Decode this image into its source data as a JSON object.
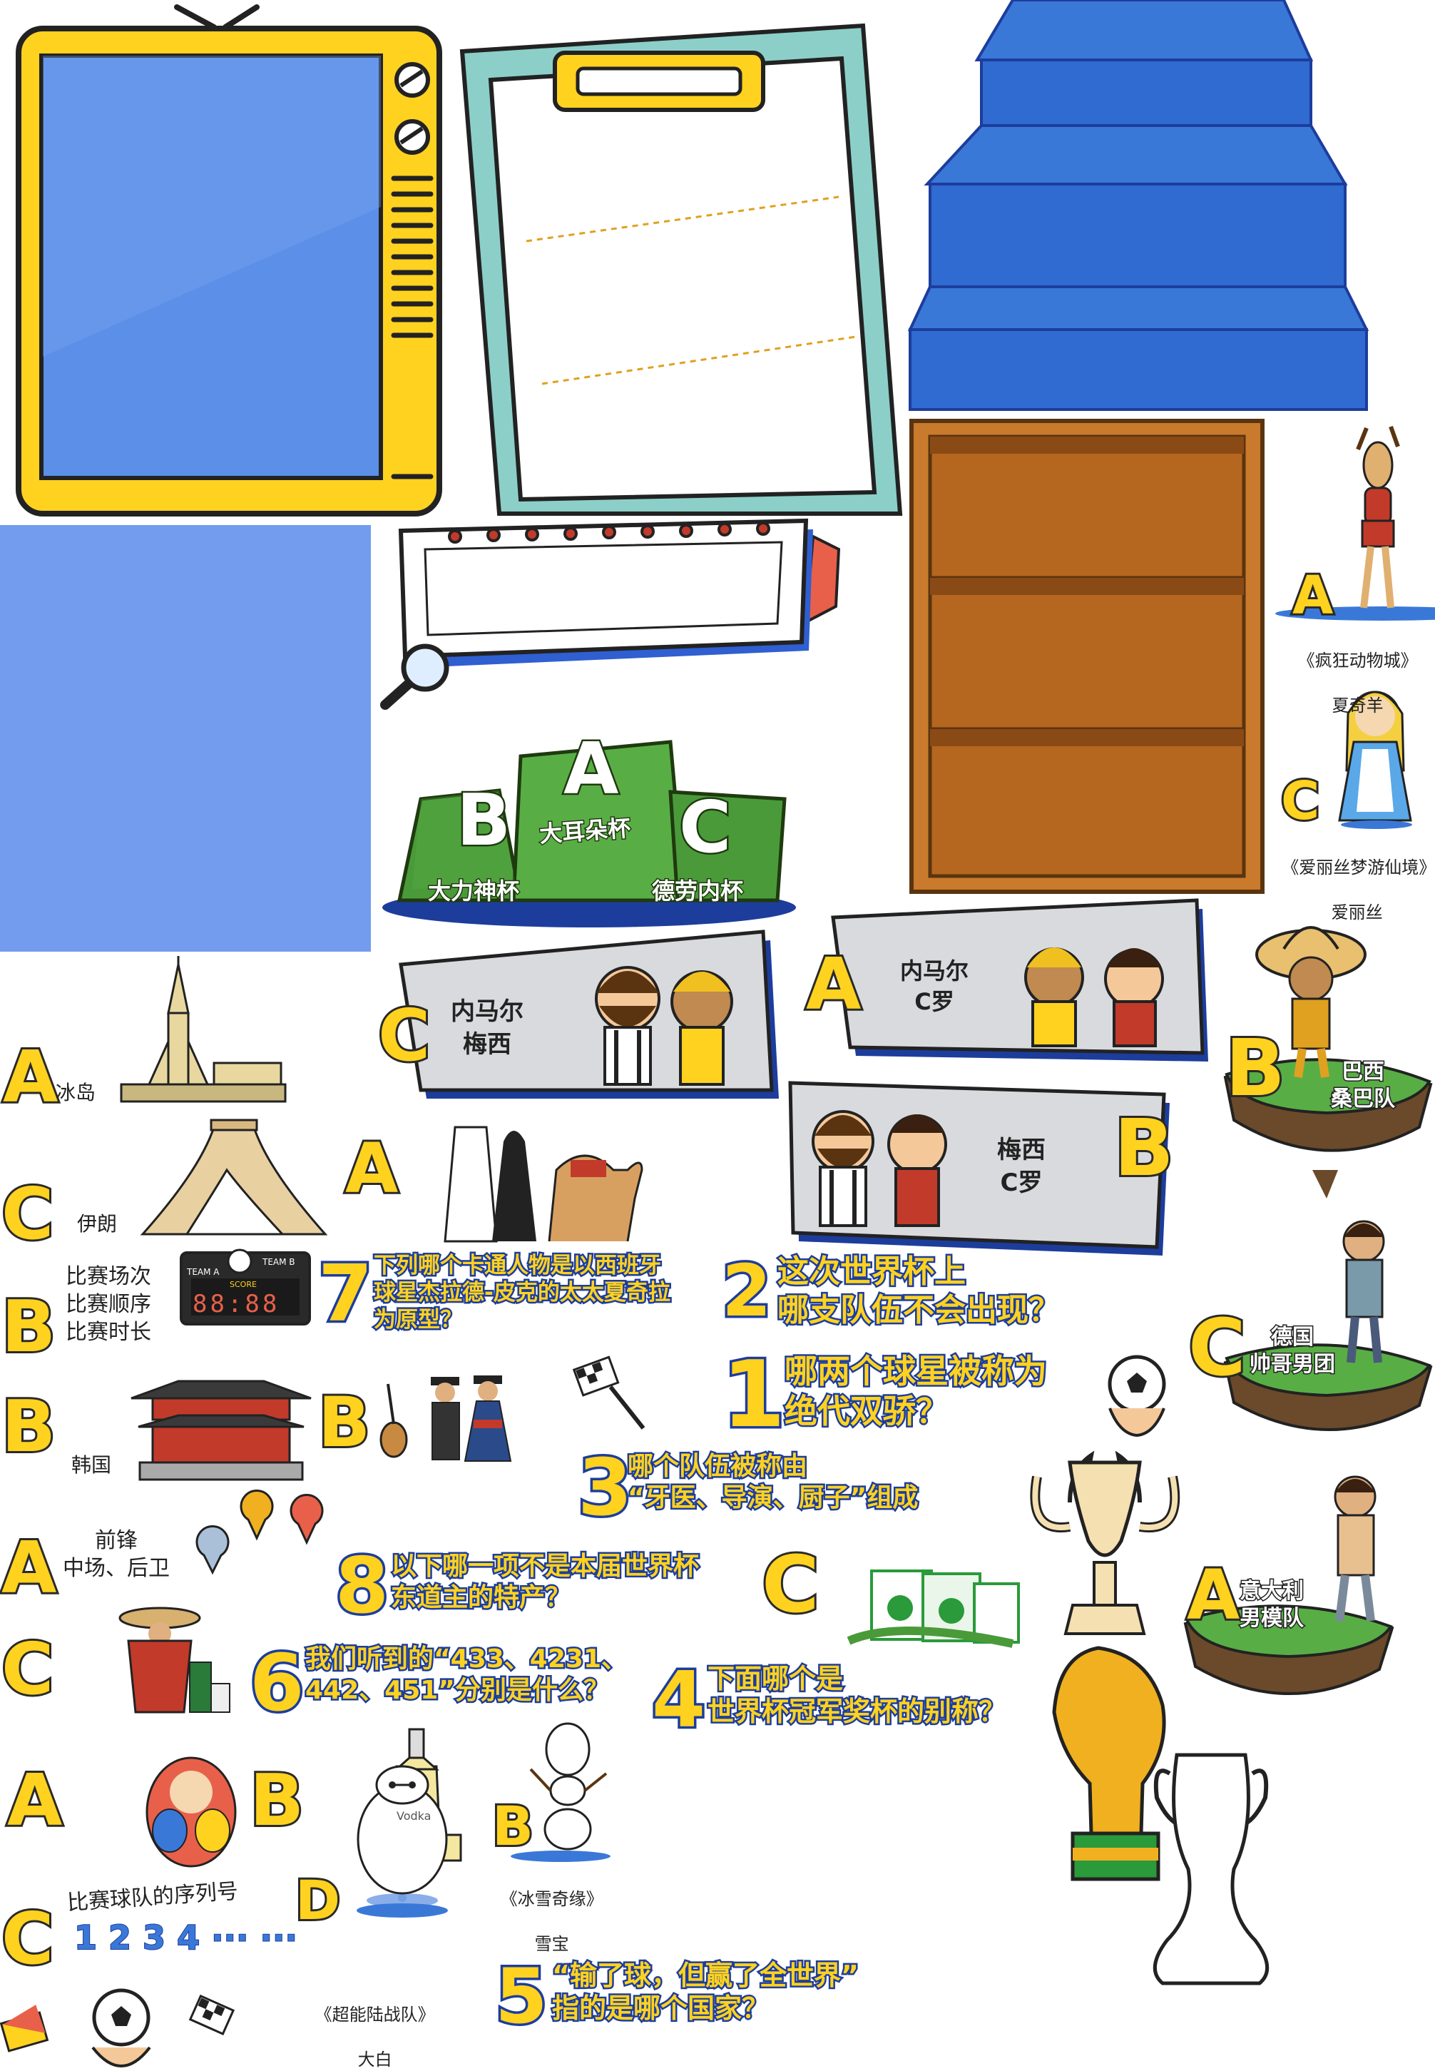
{
  "colors": {
    "accent_yellow": "#ffd21f",
    "outline_blue": "#1d3d9c",
    "tv_screen": "#5b8fe8",
    "stage_blue": "#3a78d8",
    "panel_blue": "#739cef",
    "pedestal_green": "#4a9a3a",
    "shelf_brown": "#b5661f",
    "clipboard_teal": "#8ccfc8"
  },
  "podium": {
    "a_letter": "A",
    "b_letter": "B",
    "c_letter": "C",
    "a_label": "大耳朵杯",
    "b_label": "大力神杯",
    "c_label": "德劳内杯"
  },
  "character_options": {
    "zootopia": {
      "letter": "A",
      "line1": "《疯狂动物城》",
      "line2": "夏奇羊"
    },
    "alice": {
      "letter": "C",
      "line1": "《爱丽丝梦游仙境》",
      "line2": "爱丽丝"
    },
    "olaf": {
      "letter": "B",
      "line1": "《冰雪奇缘》",
      "line2": "雪宝"
    },
    "baymax": {
      "letter": "D",
      "line1": "《超能陆战队》",
      "line2": "大白"
    }
  },
  "star_cards": {
    "card_c": {
      "letter": "C",
      "text": "内马尔\n梅西"
    },
    "card_a": {
      "letter": "A",
      "text": "内马尔\nC罗"
    },
    "card_b": {
      "letter": "B",
      "text": "梅西\nC罗"
    }
  },
  "team_options": {
    "brazil": {
      "letter": "B",
      "text": "巴西\n桑巴队"
    },
    "germany": {
      "letter": "C",
      "text": "德国\n帅哥男团"
    },
    "italy": {
      "letter": "A",
      "text": "意大利\n男模队"
    }
  },
  "country_options": {
    "iceland": {
      "letter": "A",
      "text": "冰岛"
    },
    "iran": {
      "letter": "C",
      "text": "伊朗"
    },
    "korea": {
      "letter": "B",
      "text": "韩国"
    },
    "saudi": {
      "letter": "A"
    },
    "peru": {
      "letter": "B"
    },
    "mexico": {
      "letter": "C"
    },
    "russia_a": {
      "letter": "A"
    },
    "russia_b": {
      "letter": "B"
    }
  },
  "formation_options": {
    "b": {
      "letter": "B",
      "text": "比赛场次\n比赛顺序\n比赛时长"
    },
    "a": {
      "letter": "A",
      "text": "前锋\n中场、后卫"
    },
    "c": {
      "letter": "C",
      "text": "比赛球队的序列号",
      "digits": "1 2 3 4 ··· ···"
    }
  },
  "scoreboard": {
    "team_a": "TEAM A",
    "team_b": "TEAM B",
    "score": "SCORE",
    "digits": "88:88"
  },
  "vodka_label": "Vodka",
  "product_letter": "C",
  "questions": [
    {
      "num": "7",
      "text": "下列哪个卡通人物是以西班牙\n球星杰拉德-皮克的太太夏奇拉\n为原型？"
    },
    {
      "num": "2",
      "text": "这次世界杯上\n哪支队伍不会出现？"
    },
    {
      "num": "1",
      "text": "哪两个球星被称为\n绝代双骄？"
    },
    {
      "num": "3",
      "text": "哪个队伍被称由\n“牙医、导演、厨子”组成"
    },
    {
      "num": "8",
      "text": "以下哪一项不是本届世界杯\n东道主的特产？"
    },
    {
      "num": "6",
      "text": "我们听到的“433、4231、\n442、451”分别是什么？"
    },
    {
      "num": "4",
      "text": "下面哪个是\n世界杯冠军奖杯的别称？"
    },
    {
      "num": "5",
      "text": "“输了球，但赢了全世界”\n指的是哪个国家？"
    }
  ]
}
